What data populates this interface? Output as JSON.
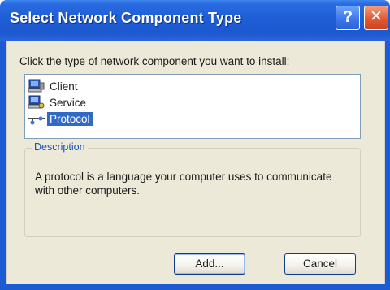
{
  "window": {
    "title": "Select Network Component Type"
  },
  "title_buttons": {
    "help_glyph": "?",
    "close_glyph": "✕"
  },
  "content": {
    "instruction": "Click the type of network component you want to install:",
    "components": [
      {
        "label": "Client",
        "icon": "client-computer-icon",
        "selected": false
      },
      {
        "label": "Service",
        "icon": "service-computer-icon",
        "selected": false
      },
      {
        "label": "Protocol",
        "icon": "protocol-network-icon",
        "selected": true
      }
    ]
  },
  "description": {
    "legend": "Description",
    "text": "A protocol is a language your computer uses to communicate with other computers."
  },
  "buttons": {
    "add": "Add...",
    "cancel": "Cancel"
  },
  "colors": {
    "titlebar": "#1f5ed6",
    "dialog_face": "#ece9d8",
    "selection": "#316ac5",
    "close_button": "#e2592f"
  }
}
